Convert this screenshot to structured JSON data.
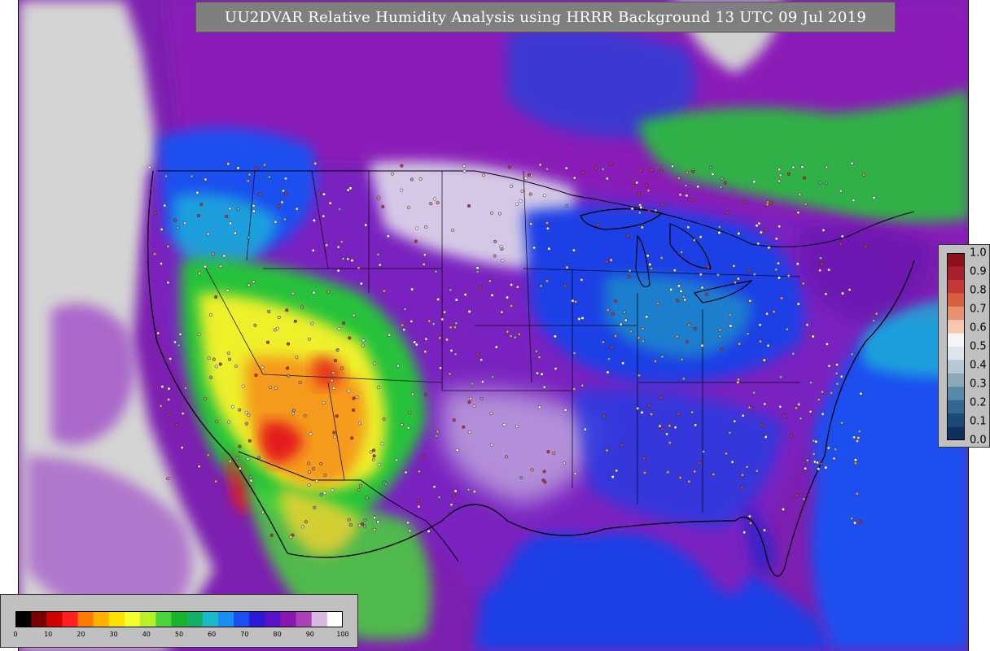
{
  "title": "UU2DVAR Relative Humidity Analysis using HRRR Background 13 UTC 09 Jul 2019",
  "colors": {
    "missing_gray": "#d0d0d0",
    "land_purple": "#7d1fb0",
    "blue": "#1a3fe6",
    "cyan": "#1fb4d8",
    "green": "#27c23a",
    "yellow": "#eef02a",
    "orange": "#f59a1f",
    "red": "#e41a1a",
    "border": "#000000"
  },
  "bottom_colorbar": {
    "ticks": [
      "0",
      "10",
      "20",
      "30",
      "40",
      "50",
      "60",
      "70",
      "80",
      "90",
      "100"
    ],
    "colors": [
      "#000000",
      "#7a0000",
      "#d00000",
      "#ff2020",
      "#ff7a00",
      "#ffb000",
      "#ffe000",
      "#f5ff30",
      "#b8f02a",
      "#49d43a",
      "#18b52c",
      "#14b06a",
      "#1ab8c8",
      "#1a8ef0",
      "#1a4ff0",
      "#2a1ad8",
      "#5a12c8",
      "#8a18b0",
      "#b040b8",
      "#d8b8e0",
      "#ffffff"
    ]
  },
  "right_colorbar": {
    "ticks": [
      "1.0",
      "0.9",
      "0.8",
      "0.7",
      "0.6",
      "0.5",
      "0.4",
      "0.3",
      "0.2",
      "0.1",
      "0.0"
    ],
    "colors": [
      "#8b1020",
      "#a82030",
      "#c43838",
      "#d66040",
      "#e89070",
      "#f5c8b0",
      "#f5f5f5",
      "#dde4ea",
      "#b8c8d2",
      "#8aa8b8",
      "#5a88a8",
      "#356890",
      "#1a4a78",
      "#0e305e"
    ]
  }
}
